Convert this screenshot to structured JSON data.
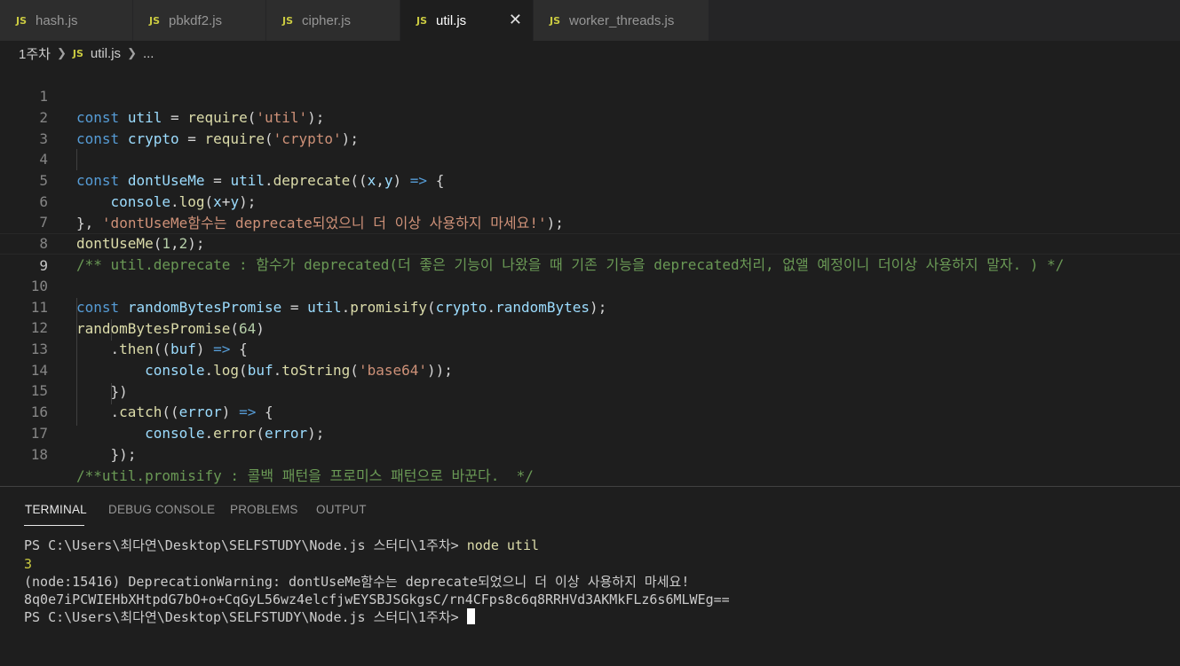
{
  "tabs": [
    {
      "icon": "JS",
      "label": "hash.js",
      "active": false
    },
    {
      "icon": "JS",
      "label": "pbkdf2.js",
      "active": false
    },
    {
      "icon": "JS",
      "label": "cipher.js",
      "active": false
    },
    {
      "icon": "JS",
      "label": "util.js",
      "active": true,
      "close": "✕"
    },
    {
      "icon": "JS",
      "label": "worker_threads.js",
      "active": false
    }
  ],
  "breadcrumb": {
    "folder": "1주차",
    "file_icon": "JS",
    "file": "util.js",
    "more": "..."
  },
  "code_lines": [
    "const util = require('util');",
    "const crypto = require('crypto');",
    "",
    "const dontUseMe = util.deprecate((x,y) => {",
    "    console.log(x+y);",
    "}, 'dontUseMe함수는 deprecate되었으니 더 이상 사용하지 마세요!');",
    "dontUseMe(1,2);",
    "/** util.deprecate : 함수가 deprecated(더 좋은 기능이 나왔을 때 기존 기능을 deprecated처리, 없앨 예정이니 더이상 사용하지 말자. ) */",
    "",
    "const randomBytesPromise = util.promisify(crypto.randomBytes);",
    "randomBytesPromise(64)",
    "    .then((buf) => {",
    "        console.log(buf.toString('base64'));",
    "    })",
    "    .catch((error) => {",
    "        console.error(error);",
    "    });",
    "/**util.promisify : 콜백 패턴을 프로미스 패턴으로 바꾼다.  */"
  ],
  "current_line": 9,
  "panel_tabs": [
    {
      "label": "TERMINAL",
      "active": true
    },
    {
      "label": "DEBUG CONSOLE",
      "active": false
    },
    {
      "label": "PROBLEMS",
      "active": false
    },
    {
      "label": "OUTPUT",
      "active": false
    }
  ],
  "terminal": {
    "prompt": "PS C:\\Users\\최다연\\Desktop\\SELFSTUDY\\Node.js 스터디\\1주차> ",
    "command": "node util",
    "output_sum": "3",
    "warning": "(node:15416) DeprecationWarning: dontUseMe함수는 deprecate되었으니 더 이상 사용하지 마세요!",
    "base64": "8q0e7iPCWIEHbXHtpdG7bO+o+CqGyL56wz4elcfjwEYSBJSGkgsC/rn4CFps8c6q8RRHVd3AKMkFLz6s6MLWEg==",
    "prompt2": "PS C:\\Users\\최다연\\Desktop\\SELFSTUDY\\Node.js 스터디\\1주차> "
  },
  "colors": {
    "keyword": "#569cd6",
    "variable": "#9cdcfe",
    "function": "#dcdcaa",
    "string": "#ce9178",
    "comment": "#6a9955",
    "number": "#b5cea8",
    "terminal_cmd": "#dcdcaa",
    "terminal_number": "#cbcb41",
    "js_icon": "#cbcb41"
  }
}
